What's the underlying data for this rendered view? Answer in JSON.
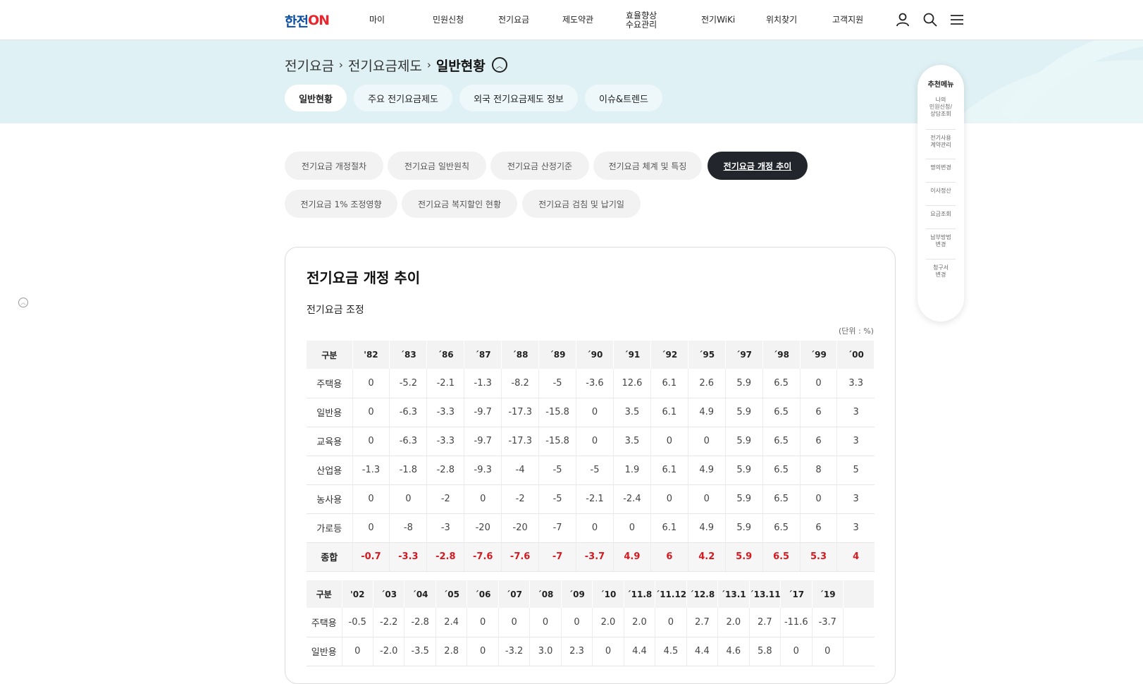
{
  "header": {
    "logo_text": "한전",
    "logo_on": "ON",
    "nav": [
      "마이",
      "민원신청",
      "전기요금",
      "제도약관",
      "효율향상\n수요관리",
      "전기WiKi",
      "위치찾기",
      "고객지원"
    ],
    "icons": [
      "user-icon",
      "search-icon",
      "menu-icon"
    ]
  },
  "breadcrumb": {
    "items": [
      "전기요금",
      "전기요금제도"
    ],
    "current": "일반현황",
    "separator": "›"
  },
  "top_tabs": [
    "일반현황",
    "주요 전기요금제도",
    "외국 전기요금제도 정보",
    "이슈&트렌드"
  ],
  "sub_tabs": [
    "전기요금 개정절차",
    "전기요금 일반원칙",
    "전기요금 산정기준",
    "전기요금 체계 및 특징",
    "전기요금 개정 추이",
    "전기요금 1% 조정영향",
    "전기요금 복지할인 현황",
    "전기요금 검침 및 납기일"
  ],
  "content": {
    "title": "전기요금 개정 추이",
    "subtitle": "전기요금 조정",
    "unit": "(단위 : %)"
  },
  "table1": {
    "header": [
      "구분",
      "'82",
      "´83",
      "´86",
      "´87",
      "´88",
      "´89",
      "´90",
      "´91",
      "´92",
      "´95",
      "´97",
      "´98",
      "´99",
      "´00"
    ],
    "rows": [
      {
        "label": "주택용",
        "values": [
          "0",
          "-5.2",
          "-2.1",
          "-1.3",
          "-8.2",
          "-5",
          "-3.6",
          "12.6",
          "6.1",
          "2.6",
          "5.9",
          "6.5",
          "0",
          "3.3"
        ]
      },
      {
        "label": "일반용",
        "values": [
          "0",
          "-6.3",
          "-3.3",
          "-9.7",
          "-17.3",
          "-15.8",
          "0",
          "3.5",
          "6.1",
          "4.9",
          "5.9",
          "6.5",
          "6",
          "3"
        ]
      },
      {
        "label": "교육용",
        "values": [
          "0",
          "-6.3",
          "-3.3",
          "-9.7",
          "-17.3",
          "-15.8",
          "0",
          "3.5",
          "0",
          "0",
          "5.9",
          "6.5",
          "6",
          "3"
        ]
      },
      {
        "label": "산업용",
        "values": [
          "-1.3",
          "-1.8",
          "-2.8",
          "-9.3",
          "-4",
          "-5",
          "-5",
          "1.9",
          "6.1",
          "4.9",
          "5.9",
          "6.5",
          "8",
          "5"
        ]
      },
      {
        "label": "농사용",
        "values": [
          "0",
          "0",
          "-2",
          "0",
          "-2",
          "-5",
          "-2.1",
          "-2.4",
          "0",
          "0",
          "5.9",
          "6.5",
          "0",
          "3"
        ]
      },
      {
        "label": "가로등",
        "values": [
          "0",
          "-8",
          "-3",
          "-20",
          "-20",
          "-7",
          "0",
          "0",
          "6.1",
          "4.9",
          "5.9",
          "6.5",
          "6",
          "3"
        ]
      }
    ],
    "total": {
      "label": "종합",
      "values": [
        "-0.7",
        "-3.3",
        "-2.8",
        "-7.6",
        "-7.6",
        "-7",
        "-3.7",
        "4.9",
        "6",
        "4.2",
        "5.9",
        "6.5",
        "5.3",
        "4"
      ]
    }
  },
  "table2": {
    "header": [
      "구분",
      "'02",
      "´03",
      "´04",
      "´05",
      "´06",
      "´07",
      "´08",
      "´09",
      "´10",
      "´11.8",
      "´11.12",
      "´12.8",
      "´13.1",
      "´13.11",
      "´17",
      "´19",
      ""
    ],
    "rows": [
      {
        "label": "주택용",
        "values": [
          "-0.5",
          "-2.2",
          "-2.8",
          "2.4",
          "0",
          "0",
          "0",
          "0",
          "2.0",
          "2.0",
          "0",
          "2.7",
          "2.0",
          "2.7",
          "-11.6",
          "-3.7",
          ""
        ]
      },
      {
        "label": "일반용",
        "values": [
          "0",
          "-2.0",
          "-3.5",
          "2.8",
          "0",
          "-3.2",
          "3.0",
          "2.3",
          "0",
          "4.4",
          "4.5",
          "4.4",
          "4.6",
          "5.8",
          "0",
          "0",
          ""
        ]
      }
    ]
  },
  "quick_menu": {
    "title": "추천메뉴",
    "items": [
      "나의\n민원신청/\n상담조회",
      "전기사용\n계약관리",
      "명의변경",
      "이사정산",
      "요금조회",
      "납부방법\n변경",
      "청구서\n변경"
    ],
    "top_icon": "chevron-up-icon"
  }
}
